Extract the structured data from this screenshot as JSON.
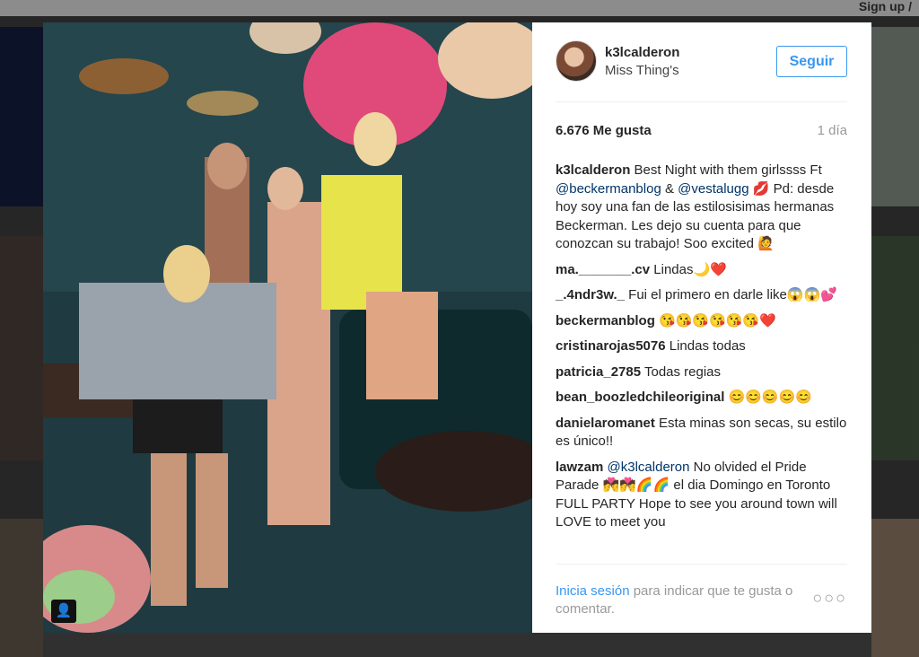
{
  "topbar": {
    "signup": "Sign up  /"
  },
  "post": {
    "username": "k3lcalderon",
    "location": "Miss Thing's",
    "follow_label": "Seguir",
    "likes": "6.676 Me gusta",
    "time": "1 día",
    "caption": {
      "user": "k3lcalderon",
      "pre": " Best Night with them girlssss Ft ",
      "m1": "@beckermanblog",
      "mid": " & ",
      "m2": "@vestalugg",
      "post": " 💋 Pd: desde hoy soy una fan de las estilosisimas hermanas Beckerman. Les dejo su cuenta para que conozcan su trabajo! Soo excited 🙋"
    },
    "comments": [
      {
        "user": "ma._______.cv",
        "text": " Lindas🌙❤️"
      },
      {
        "user": "_.4ndr3w._",
        "text": " Fui el primero en darle like😱😱💕"
      },
      {
        "user": "beckermanblog",
        "text": " 😘😘😘😘😘😘❤️"
      },
      {
        "user": "cristinarojas5076",
        "text": " Lindas todas"
      },
      {
        "user": "patricia_2785",
        "text": " Todas regias"
      },
      {
        "user": "bean_boozledchileoriginal",
        "text": " 😊😊😊😊😊"
      },
      {
        "user": "danielaromanet",
        "text": " Esta minas son secas, su estilo es único!!"
      }
    ],
    "last_comment": {
      "user": "lawzam",
      "mention": "@k3lcalderon",
      "text": " No olvided el Pride Parade 💏💏🌈🌈 el dia Domingo en Toronto FULL PARTY Hope to see you around town will LOVE to meet you"
    },
    "login_link": "Inicia sesión",
    "login_text": " para indicar que te gusta o comentar.",
    "more_icon": "more-dots-icon",
    "user_icon": "person-icon"
  }
}
